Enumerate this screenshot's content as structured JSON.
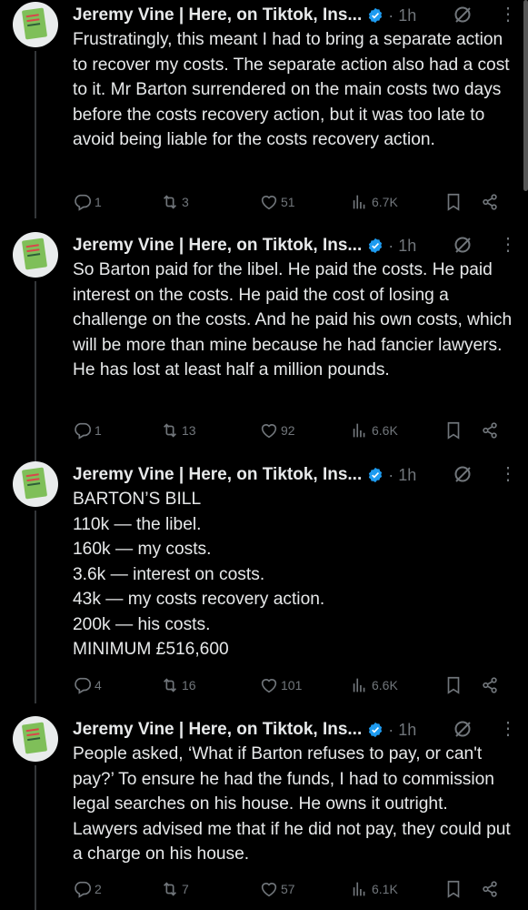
{
  "tweets": [
    {
      "author": "Jeremy Vine | Here, on Tiktok, Ins...",
      "time": "1h",
      "text": "Frustratingly, this meant I had to bring a separate action to recover my costs. The separate action also had a cost to it. Mr Barton surrendered on the main costs two days before the costs recovery action, but it was too late to avoid being liable for the costs recovery action.",
      "replies": "1",
      "reposts": "3",
      "likes": "51",
      "views": "6.7K"
    },
    {
      "author": "Jeremy Vine | Here, on Tiktok, Ins...",
      "time": "1h",
      "text": "So Barton paid for the libel. He paid the costs. He paid interest on the costs. He paid the cost of losing a challenge on the costs. And he paid his own costs, which will be more than mine because he had fancier lawyers. He has lost at least half a million pounds.",
      "replies": "1",
      "reposts": "13",
      "likes": "92",
      "views": "6.6K"
    },
    {
      "author": "Jeremy Vine | Here, on Tiktok, Ins...",
      "time": "1h",
      "text": "BARTON’S BILL\n110k — the libel.\n160k — my costs.\n3.6k — interest on costs.\n43k — my costs recovery action.\n200k — his costs.\nMINIMUM £516,600",
      "replies": "4",
      "reposts": "16",
      "likes": "101",
      "views": "6.6K"
    },
    {
      "author": "Jeremy Vine | Here, on Tiktok, Ins...",
      "time": "1h",
      "text": "People asked, ‘What if Barton refuses to pay, or can't pay?’ To ensure he had the funds, I had to commission legal searches on his house. He owns it outright. Lawyers advised me that if he did not pay, they could put a charge on his house.",
      "replies": "2",
      "reposts": "7",
      "likes": "57",
      "views": "6.1K"
    }
  ],
  "icons": {
    "verified": "verified-badge-icon",
    "grok": "grok-icon",
    "more": "more-icon",
    "reply": "reply-icon",
    "repost": "repost-icon",
    "like": "like-icon",
    "views": "views-icon",
    "bookmark": "bookmark-icon",
    "share": "share-icon"
  },
  "colors": {
    "background": "#000000",
    "text": "#e7e9ea",
    "muted": "#71767b",
    "verified": "#1d9bf0"
  }
}
